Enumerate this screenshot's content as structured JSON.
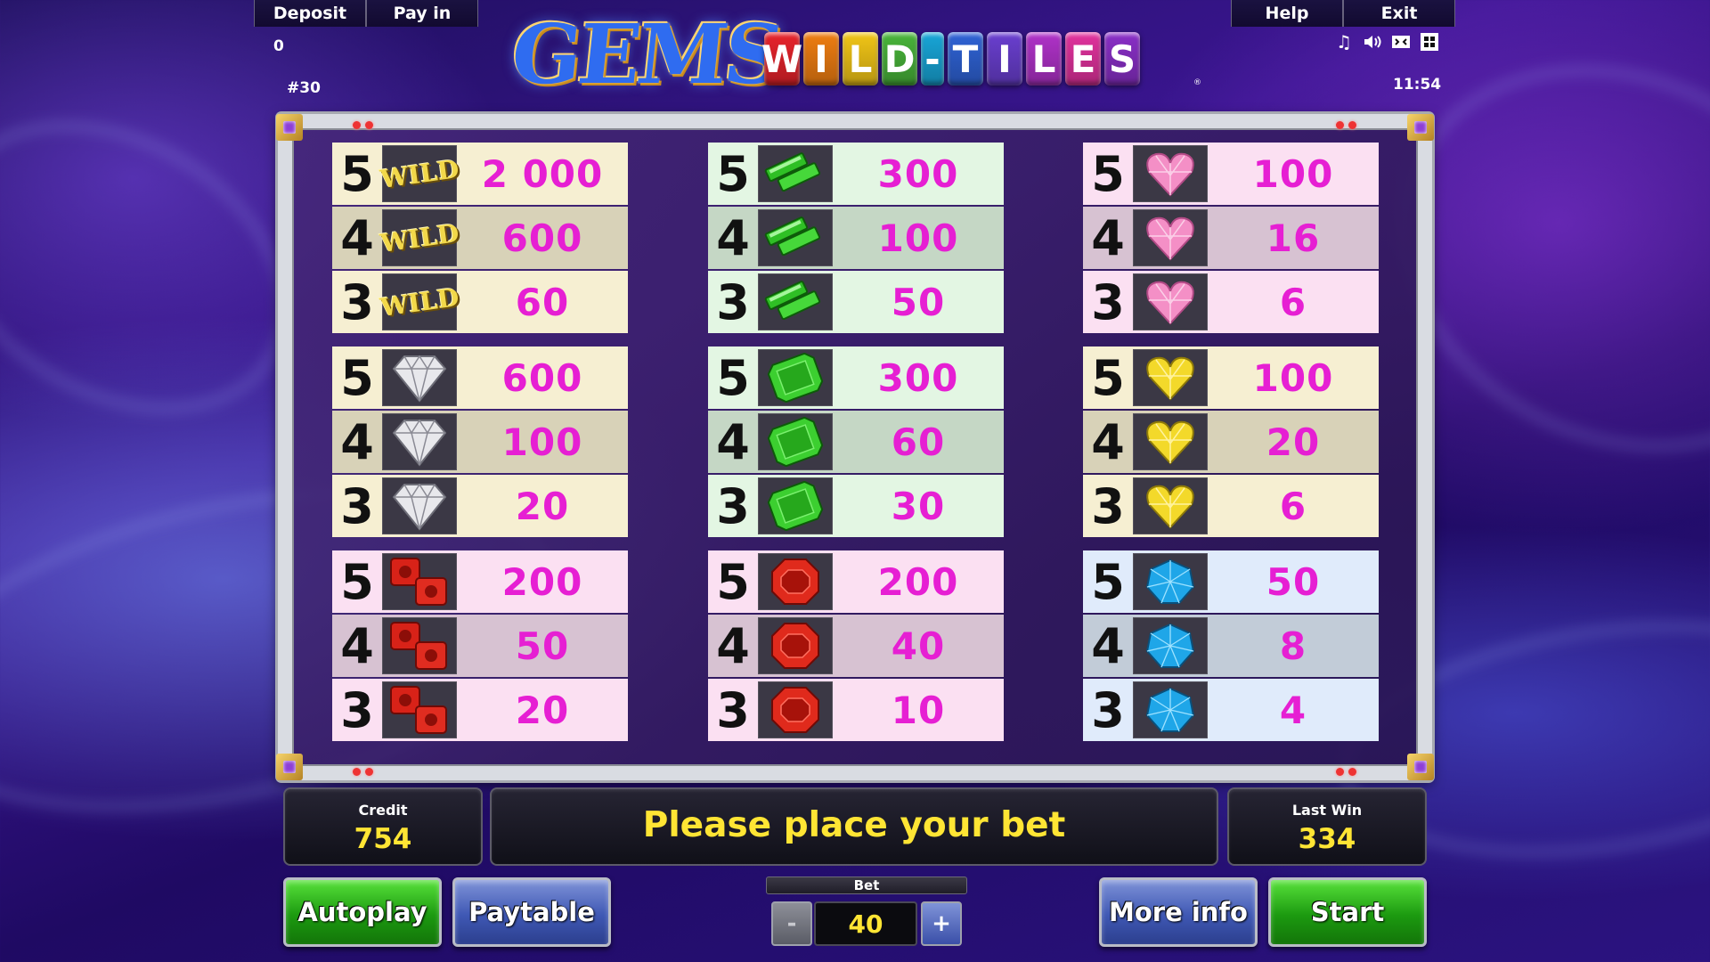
{
  "top_bar": {
    "left_buttons": [
      "Deposit",
      "Pay in"
    ],
    "right_buttons": [
      "Help",
      "Exit"
    ],
    "balance_small": "0",
    "game_number": "#30",
    "clock": "11:54"
  },
  "logo": {
    "gems": "GEMS",
    "tiles": [
      "W",
      "I",
      "L",
      "D",
      "-",
      "T",
      "I",
      "L",
      "E",
      "S"
    ],
    "tile_colors": [
      "#e8242c",
      "#f07e12",
      "#f2c617",
      "#49b53a",
      "#18a6d8",
      "#2f63d6",
      "#6a3fd0",
      "#b032c9",
      "#e2329e",
      "#8a2fc8"
    ],
    "registered": "®"
  },
  "audio_icons": [
    "music-note-icon",
    "speaker-icon",
    "screen-mode-icon",
    "fullscreen-icon"
  ],
  "paytable": [
    {
      "symbol": "wild",
      "label": "WILD",
      "bg": [
        "#f6efd2",
        "#d8d2b8",
        "#f6efd2"
      ],
      "rows": [
        {
          "count": "5",
          "value": "2 000"
        },
        {
          "count": "4",
          "value": "600"
        },
        {
          "count": "3",
          "value": "60"
        }
      ]
    },
    {
      "symbol": "green-bars",
      "label": "",
      "bg": [
        "#e3f6e3",
        "#c5d7c5",
        "#e3f6e3"
      ],
      "rows": [
        {
          "count": "5",
          "value": "300"
        },
        {
          "count": "4",
          "value": "100"
        },
        {
          "count": "3",
          "value": "50"
        }
      ]
    },
    {
      "symbol": "pink-heart",
      "label": "",
      "bg": [
        "#fbe0f2",
        "#d7c2d2",
        "#fbe0f2"
      ],
      "rows": [
        {
          "count": "5",
          "value": "100"
        },
        {
          "count": "4",
          "value": "16"
        },
        {
          "count": "3",
          "value": "6"
        }
      ]
    },
    {
      "symbol": "diamond",
      "label": "",
      "bg": [
        "#f6efd2",
        "#d8d2b8",
        "#f6efd2"
      ],
      "rows": [
        {
          "count": "5",
          "value": "600"
        },
        {
          "count": "4",
          "value": "100"
        },
        {
          "count": "3",
          "value": "20"
        }
      ]
    },
    {
      "symbol": "emerald",
      "label": "",
      "bg": [
        "#e3f6e3",
        "#c5d7c5",
        "#e3f6e3"
      ],
      "rows": [
        {
          "count": "5",
          "value": "300"
        },
        {
          "count": "4",
          "value": "60"
        },
        {
          "count": "3",
          "value": "30"
        }
      ]
    },
    {
      "symbol": "yellow-heart",
      "label": "",
      "bg": [
        "#f6efd2",
        "#d8d2b8",
        "#f6efd2"
      ],
      "rows": [
        {
          "count": "5",
          "value": "100"
        },
        {
          "count": "4",
          "value": "20"
        },
        {
          "count": "3",
          "value": "6"
        }
      ]
    },
    {
      "symbol": "red-cubes",
      "label": "",
      "bg": [
        "#fbe0f2",
        "#d7c2d2",
        "#fbe0f2"
      ],
      "rows": [
        {
          "count": "5",
          "value": "200"
        },
        {
          "count": "4",
          "value": "50"
        },
        {
          "count": "3",
          "value": "20"
        }
      ]
    },
    {
      "symbol": "ruby",
      "label": "",
      "bg": [
        "#fbe0f2",
        "#d7c2d2",
        "#fbe0f2"
      ],
      "rows": [
        {
          "count": "5",
          "value": "200"
        },
        {
          "count": "4",
          "value": "40"
        },
        {
          "count": "3",
          "value": "10"
        }
      ]
    },
    {
      "symbol": "blue-gem",
      "label": "",
      "bg": [
        "#e0ebfb",
        "#c2ccd8",
        "#e0ebfb"
      ],
      "rows": [
        {
          "count": "5",
          "value": "50"
        },
        {
          "count": "4",
          "value": "8"
        },
        {
          "count": "3",
          "value": "4"
        }
      ]
    }
  ],
  "panel": {
    "credit_label": "Credit",
    "credit_value": "754",
    "message": "Please place your bet",
    "last_win_label": "Last Win",
    "last_win_value": "334"
  },
  "controls": {
    "autoplay": "Autoplay",
    "paytable": "Paytable",
    "bet_label": "Bet",
    "bet_value": "40",
    "minus": "-",
    "plus": "+",
    "more_info": "More info",
    "start": "Start"
  }
}
